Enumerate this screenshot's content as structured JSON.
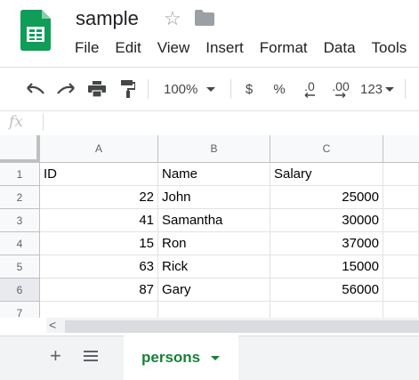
{
  "document": {
    "title": "sample"
  },
  "menu": {
    "items": [
      "File",
      "Edit",
      "View",
      "Insert",
      "Format",
      "Data",
      "Tools"
    ]
  },
  "toolbar": {
    "zoom": "100%",
    "currency": "$",
    "percent": "%",
    "decrease_decimal": ".0",
    "increase_decimal": ".00",
    "more_formats": "123"
  },
  "formula_bar": {
    "fx_label": "fx",
    "value": ""
  },
  "grid": {
    "columns": [
      "A",
      "B",
      "C"
    ],
    "rows": [
      "1",
      "2",
      "3",
      "4",
      "5",
      "6",
      "7"
    ],
    "cells": [
      [
        "ID",
        "Name",
        "Salary"
      ],
      [
        "22",
        "John",
        "25000"
      ],
      [
        "41",
        "Samantha",
        "30000"
      ],
      [
        "15",
        "Ron",
        "37000"
      ],
      [
        "63",
        "Rick",
        "15000"
      ],
      [
        "87",
        "Gary",
        "56000"
      ],
      [
        "",
        "",
        ""
      ]
    ]
  },
  "scrollbar": {
    "left_arrow": "<"
  },
  "sheets": {
    "add_symbol": "+",
    "tabs": [
      {
        "label": "persons",
        "active": true
      }
    ]
  },
  "colors": {
    "logo_green": "#0f9d58",
    "active_tab_text": "#188038",
    "header_bg": "#f8f9fa"
  }
}
